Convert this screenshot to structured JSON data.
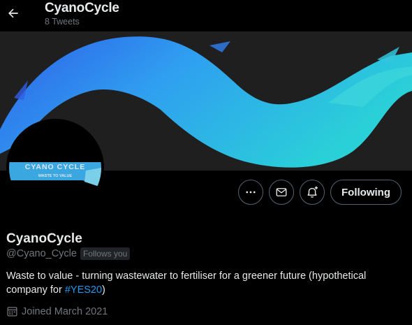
{
  "header": {
    "title": "CyanoCycle",
    "tweet_count": "8 Tweets"
  },
  "avatar": {
    "line1": "CYANO CYCLE",
    "line2": "WASTE TO VALUE"
  },
  "actions": {
    "following_label": "Following"
  },
  "profile": {
    "name": "CyanoCycle",
    "handle": "@Cyano_Cycle",
    "follows_you": "Follows you",
    "bio_text": "Waste to value - turning wastewater to fertiliser for a greener future (hypothetical company for ",
    "bio_hashtag": "#YES20",
    "bio_end": ")",
    "joined": "Joined March 2021"
  },
  "colors": {
    "background": "#000000",
    "accent": "#1d9bf0",
    "banner_gradient_start": "#2f6ff0",
    "banner_gradient_end": "#2ad0d8"
  }
}
